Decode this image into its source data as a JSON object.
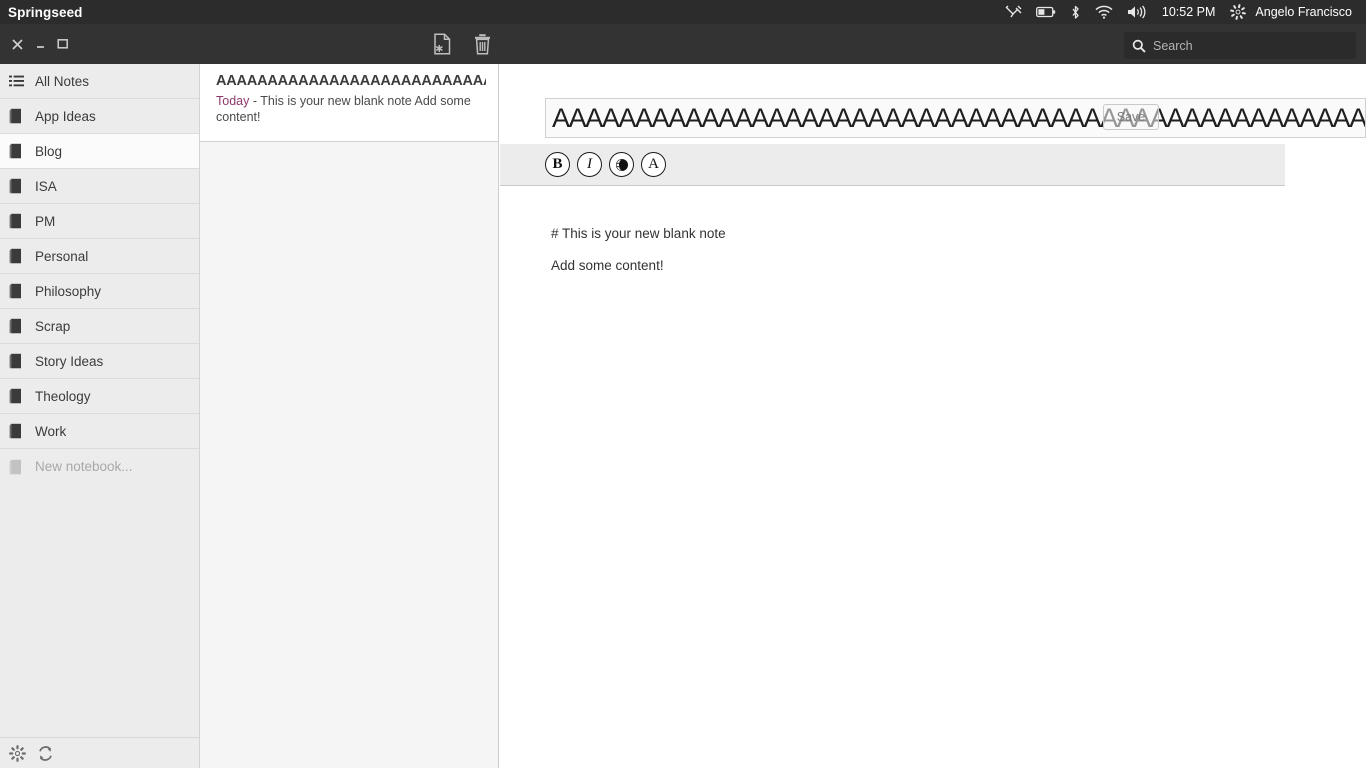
{
  "unity_panel": {
    "app_name": "Springseed",
    "tray": [
      {
        "name": "keyboard-indicator-icon",
        "glyph": "kbd"
      },
      {
        "name": "battery-icon",
        "glyph": "battery"
      },
      {
        "name": "bluetooth-icon",
        "glyph": "bluetooth"
      },
      {
        "name": "wifi-icon",
        "glyph": "wifi"
      },
      {
        "name": "volume-icon",
        "glyph": "volume"
      }
    ],
    "clock": "10:52 PM",
    "settings_icon": "gear-icon",
    "user": "Angelo Francisco"
  },
  "titlebar": {
    "close_label": "×",
    "minimize_label": "–",
    "maximize_label": "□",
    "new_note_icon": "new-note-icon",
    "delete_note_icon": "trash-icon"
  },
  "search": {
    "icon": "search-icon",
    "placeholder": "Search",
    "value": ""
  },
  "sidebar": {
    "items": [
      {
        "label": "All Notes",
        "icon": "list-icon",
        "selected": false
      },
      {
        "label": "App Ideas",
        "icon": "notebook-icon",
        "selected": false
      },
      {
        "label": "Blog",
        "icon": "notebook-icon",
        "selected": true
      },
      {
        "label": "ISA",
        "icon": "notebook-icon",
        "selected": false
      },
      {
        "label": "PM",
        "icon": "notebook-icon",
        "selected": false
      },
      {
        "label": "Personal",
        "icon": "notebook-icon",
        "selected": false
      },
      {
        "label": "Philosophy",
        "icon": "notebook-icon",
        "selected": false
      },
      {
        "label": "Scrap",
        "icon": "notebook-icon",
        "selected": false
      },
      {
        "label": "Story Ideas",
        "icon": "notebook-icon",
        "selected": false
      },
      {
        "label": "Theology",
        "icon": "notebook-icon",
        "selected": false
      },
      {
        "label": "Work",
        "icon": "notebook-icon",
        "selected": false
      },
      {
        "label": "New notebook...",
        "icon": "notebook-icon",
        "selected": false
      }
    ],
    "footer": {
      "settings_icon": "gear-icon",
      "sync_icon": "sync-icon"
    }
  },
  "note_list": {
    "items": [
      {
        "title": "AAAAAAAAAAAAAAAAAAAAAAAAAAAAAAAAAAAAAAAAAAAAAA",
        "date": "Today",
        "separator": " - ",
        "preview": "This is your new blank note Add some content!"
      }
    ]
  },
  "editor": {
    "title_value": "AAAAAAAAAAAAAAAAAAAAAAAAAAAAAAAAAAAAAAAAAAAAAAAAAAAAAAAAAAAAA",
    "save_label": "Save",
    "toolbar": [
      {
        "name": "bold-button",
        "label": "B"
      },
      {
        "name": "italic-button",
        "label": "I"
      },
      {
        "name": "link-button",
        "label": ""
      },
      {
        "name": "font-button",
        "label": "A"
      }
    ],
    "body_lines": [
      "# This is your new blank note",
      "Add some content!"
    ]
  },
  "colors": {
    "panel_bg": "#2c2c2c",
    "titlebar_bg": "#333333",
    "sidebar_bg": "#ececec",
    "sidebar_selected_bg": "#fbfbfb",
    "note_date_accent": "#8c3a6b",
    "toolbar_bg": "#ececec"
  }
}
